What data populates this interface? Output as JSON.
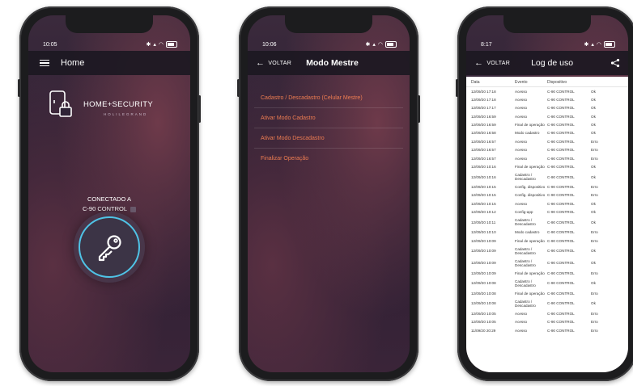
{
  "phone1": {
    "status_time": "10:05",
    "title": "Home",
    "brand_name": "HOME+SECURITY",
    "brand_sub": "HOLILEGRAND",
    "connected_label": "CONECTADO A",
    "device_name": "C-90 CONTROL"
  },
  "phone2": {
    "status_time": "10:06",
    "back_label": "VOLTAR",
    "title": "Modo Mestre",
    "items": [
      {
        "label": "Cadastro / Descadastro (Celular Mestre)"
      },
      {
        "label": "Ativar Modo Cadastro"
      },
      {
        "label": "Ativar Modo Descadastro"
      },
      {
        "label": "Finalizar Operação"
      }
    ]
  },
  "phone3": {
    "status_time": "8:17",
    "back_label": "VOLTAR",
    "title": "Log de uso",
    "headers": [
      "Data",
      "Evento",
      "Dispositivo",
      ""
    ],
    "rows": [
      [
        "12/09/20 17:18",
        "Acesso",
        "C-90 CONTROL",
        "Ok"
      ],
      [
        "12/09/20 17:18",
        "Acesso",
        "C-90 CONTROL",
        "Ok"
      ],
      [
        "12/09/20 17:17",
        "Acesso",
        "C-90 CONTROL",
        "Ok"
      ],
      [
        "12/09/20 16:59",
        "Acesso",
        "C-90 CONTROL",
        "Ok"
      ],
      [
        "12/09/20 16:59",
        "Final de operação",
        "C-90 CONTROL",
        "Ok"
      ],
      [
        "12/09/20 16:58",
        "Modo cadastro",
        "C-90 CONTROL",
        "Ok"
      ],
      [
        "12/09/20 16:57",
        "Acesso",
        "C-90 CONTROL",
        "Erro"
      ],
      [
        "12/09/20 16:57",
        "Acesso",
        "C-90 CONTROL",
        "Erro"
      ],
      [
        "12/09/20 16:57",
        "Acesso",
        "C-90 CONTROL",
        "Erro"
      ],
      [
        "12/09/20 10:16",
        "Final de operação",
        "C-90 CONTROL",
        "Ok"
      ],
      [
        "12/09/20 10:16",
        "Cadastro / Descadastro",
        "C-90 CONTROL",
        "Ok"
      ],
      [
        "12/09/20 10:15",
        "Config. dispositivo",
        "C-90 CONTROL",
        "Erro"
      ],
      [
        "12/09/20 10:15",
        "Config. dispositivo",
        "C-90 CONTROL",
        "Erro"
      ],
      [
        "12/09/20 10:15",
        "Acesso",
        "C-90 CONTROL",
        "Ok"
      ],
      [
        "12/09/20 10:12",
        "Config-app",
        "C-90 CONTROL",
        "Ok"
      ],
      [
        "12/09/20 10:11",
        "Cadastro / Descadastro",
        "C-90 CONTROL",
        "Ok"
      ],
      [
        "12/09/20 10:10",
        "Modo cadastro",
        "C-90 CONTROL",
        "Erro"
      ],
      [
        "12/09/20 10:09",
        "Final de operação",
        "C-90 CONTROL",
        "Erro"
      ],
      [
        "12/09/20 10:09",
        "Cadastro / Descadastro",
        "C-90 CONTROL",
        "Ok"
      ],
      [
        "12/09/20 10:09",
        "Cadastro / Descadastro",
        "C-90 CONTROL",
        "Ok"
      ],
      [
        "12/09/20 10:09",
        "Final de operação",
        "C-90 CONTROL",
        "Erro"
      ],
      [
        "12/09/20 10:08",
        "Cadastro / Descadastro",
        "C-90 CONTROL",
        "Ok"
      ],
      [
        "12/09/20 10:08",
        "Final de operação",
        "C-90 CONTROL",
        "Erro"
      ],
      [
        "12/09/20 10:08",
        "Cadastro / Descadastro",
        "C-90 CONTROL",
        "Ok"
      ],
      [
        "12/09/20 10:05",
        "Acesso",
        "C-90 CONTROL",
        "Erro"
      ],
      [
        "12/09/20 10:05",
        "Acesso",
        "C-90 CONTROL",
        "Erro"
      ],
      [
        "11/09/20 20:29",
        "Acesso",
        "C-90 CONTROL",
        "Erro"
      ]
    ]
  },
  "colors": {
    "accent_orange": "#ee7d52",
    "key_ring": "#4fc3e6",
    "appbar": "#1c1822"
  }
}
